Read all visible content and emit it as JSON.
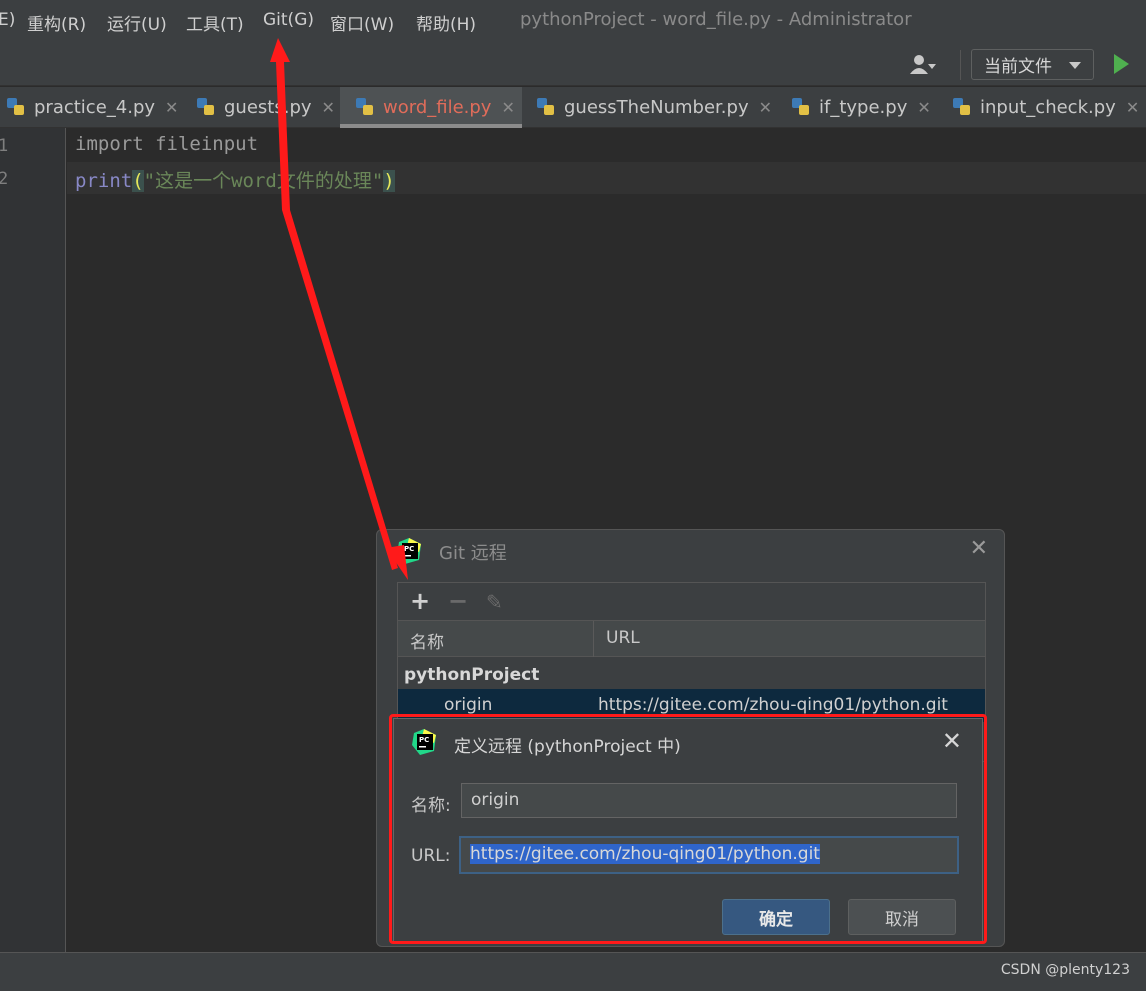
{
  "menubar": {
    "items": [
      "E)",
      "重构(R)",
      "运行(U)",
      "工具(T)",
      "Git(G)",
      "窗口(W)",
      "帮助(H)"
    ],
    "window_title": "pythonProject - word_file.py - Administrator"
  },
  "toolbar": {
    "user_icon": "user-icon",
    "run_config": "当前文件",
    "run_icon": "run-icon"
  },
  "tabs": [
    {
      "label": "practice_4.py",
      "active": false
    },
    {
      "label": "guests.py",
      "active": false
    },
    {
      "label": "word_file.py",
      "active": true
    },
    {
      "label": "guessTheNumber.py",
      "active": false
    },
    {
      "label": "if_type.py",
      "active": false
    },
    {
      "label": "input_check.py",
      "active": false
    }
  ],
  "editor": {
    "line_numbers": [
      "1",
      "2"
    ],
    "line1": "import fileinput",
    "line2_fn": "print",
    "line2_open": "(",
    "line2_str": "\"这是一个word文件的处理\"",
    "line2_close": ")"
  },
  "git_dialog": {
    "title": "Git 远程",
    "tools": {
      "add": "+",
      "remove": "−"
    },
    "col_name": "名称",
    "col_url": "URL",
    "group": "pythonProject",
    "rows": [
      {
        "name": "origin",
        "url": "https://gitee.com/zhou-qing01/python.git"
      }
    ]
  },
  "define_remote": {
    "title": "定义远程 (pythonProject 中)",
    "name_label": "名称:",
    "name_value": "origin",
    "url_label": "URL:",
    "url_value": "https://gitee.com/zhou-qing01/python.git",
    "ok_label": "确定",
    "cancel_label": "取消"
  },
  "watermark": "CSDN @plenty123",
  "colors": {
    "annotation": "#ff1a1a",
    "active_tab_text": "#e06c5a",
    "primary_button": "#365880"
  }
}
